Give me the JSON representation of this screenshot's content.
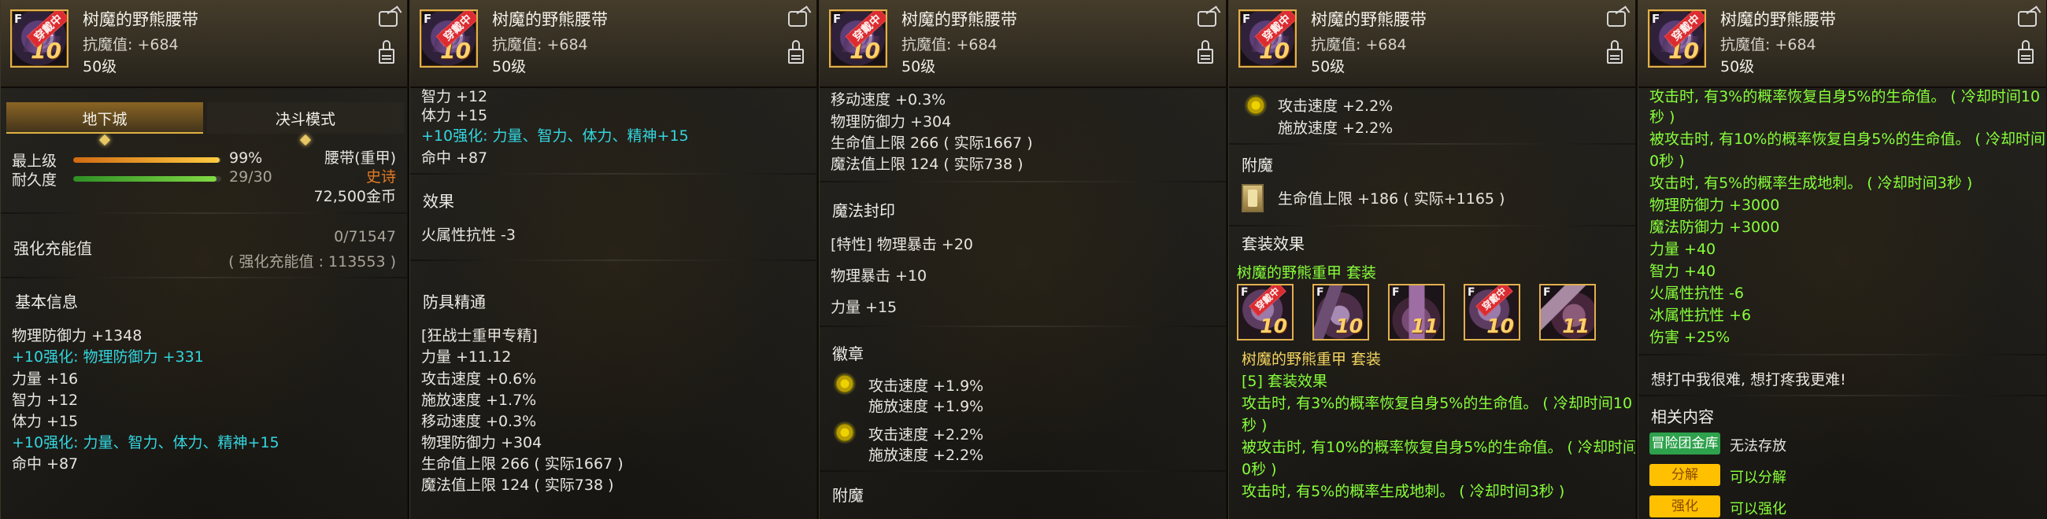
{
  "item": {
    "name": "树魔的野熊腰带",
    "resist": "抗魔值: +684",
    "level": "50级",
    "equipped_badge": "穿戴中",
    "tier_mark": "F",
    "upgrade_level": "10"
  },
  "panel1": {
    "tabs": {
      "dungeon": "地下城",
      "pvp": "决斗模式"
    },
    "stats": {
      "top_label": "最上级",
      "top_value": "99%",
      "top_progress": 0.99,
      "durability_label": "耐久度",
      "durability_value": "29/30",
      "durability_progress": 0.967,
      "slot": "腰带(重甲)",
      "rarity": "史诗",
      "price": "72,500金币"
    },
    "charge": {
      "label": "强化充能值",
      "value": "0/71547",
      "extra": "( 强化充能值 : 113553 )"
    },
    "basic_title": "基本信息",
    "basic_lines": [
      "物理防御力 +1348",
      "+10强化: 物理防御力 +331",
      "力量 +16",
      "智力 +12",
      "体力 +15",
      "+10强化: 力量、智力、体力、精神+15",
      "命中 +87"
    ]
  },
  "panel2": {
    "top_lines": [
      "智力 +12",
      "体力 +15",
      "+10强化: 力量、智力、体力、精神+15",
      "命中 +87"
    ],
    "effect_title": "效果",
    "effect_lines": [
      "火属性抗性 -3"
    ],
    "mastery_title": "防具精通",
    "mastery_lines": [
      "[狂战士重甲专精]",
      "力量 +11.12",
      "攻击速度 +0.6%",
      "施放速度 +1.7%",
      "移动速度 +0.3%",
      "物理防御力 +304",
      "生命值上限 266 ( 实际1667 )",
      "魔法值上限 124 ( 实际738 )"
    ]
  },
  "panel3": {
    "top_lines": [
      "移动速度 +0.3%",
      "物理防御力 +304",
      "生命值上限 266 ( 实际1667 )",
      "魔法值上限 124 ( 实际738 )"
    ],
    "seal_title": "魔法封印",
    "seal_lines": [
      "[特性] 物理暴击 +20",
      "物理暴击 +10",
      "力量 +15"
    ],
    "emblem_title": "徽章",
    "emblems": [
      {
        "line1": "攻击速度 +1.9%",
        "line2": "施放速度 +1.9%"
      },
      {
        "line1": "攻击速度 +2.2%",
        "line2": "施放速度 +2.2%"
      }
    ],
    "enchant_title": "附魔"
  },
  "panel4": {
    "emblem": {
      "line1": "攻击速度 +2.2%",
      "line2": "施放速度 +2.2%"
    },
    "enchant_title": "附魔",
    "enchant_line": "生命值上限 +186 ( 实际+1165 )",
    "set_effect_title": "套装效果",
    "set_name": "树魔的野熊重甲 套装",
    "set_icons": [
      {
        "type": "head",
        "tier": "F",
        "level": "10",
        "badge": "穿戴中"
      },
      {
        "type": "armor",
        "tier": "F",
        "level": "10",
        "badge": ""
      },
      {
        "type": "leg",
        "tier": "F",
        "level": "11",
        "badge": ""
      },
      {
        "type": "belt",
        "tier": "F",
        "level": "10",
        "badge": "穿戴中"
      },
      {
        "type": "boot",
        "tier": "F",
        "level": "11",
        "badge": ""
      }
    ],
    "set_name_second": "树魔的野熊重甲 套装",
    "set_count": "[5] 套装效果",
    "set_lines": [
      "攻击时, 有3%的概率恢复自身5%的生命值。 ( 冷却时间10",
      "秒 )",
      "被攻击时, 有10%的概率恢复自身5%的生命值。 ( 冷却时间1",
      "0秒 )",
      "攻击时, 有5%的概率生成地刺。 ( 冷却时间3秒 )"
    ]
  },
  "panel5": {
    "lines": [
      "攻击时, 有3%的概率恢复自身5%的生命值。 ( 冷却时间10",
      "秒 )",
      "被攻击时, 有10%的概率恢复自身5%的生命值。 ( 冷却时间1",
      "0秒 )",
      "攻击时, 有5%的概率生成地刺。 ( 冷却时间3秒 )",
      "物理防御力 +3000",
      "魔法防御力 +3000",
      "力量 +40",
      "智力 +40",
      "火属性抗性 -6",
      "冰属性抗性 +6",
      "伤害 +25%"
    ],
    "flavor": "想打中我很难, 想打疼我更难!",
    "related_title": "相关内容",
    "related": [
      {
        "tag": "冒险团金库",
        "text": "无法存放"
      },
      {
        "tag": "分解",
        "text": "可以分解"
      },
      {
        "tag": "强化",
        "text": "可以强化"
      }
    ]
  },
  "colors": {
    "background": "#0d0b08",
    "panel": "#22201b",
    "text": "#e8e6df",
    "cyan": "#33d6df",
    "green": "#87ff3b",
    "gold": "#e1b04e",
    "red_badge": "#dc2c31"
  },
  "icons": {
    "share": "share-icon",
    "lock": "lock-icon",
    "item": "belt-icon",
    "emblem": "emblem-gem-icon",
    "enchant": "enchant-card-icon"
  }
}
